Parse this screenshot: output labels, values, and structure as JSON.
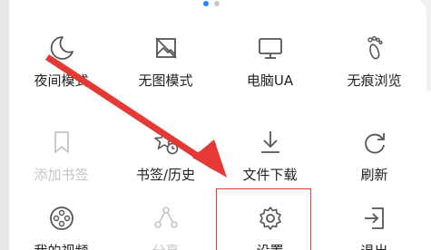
{
  "menu": {
    "rows": [
      [
        {
          "label": "夜间模式",
          "icon": "moon-icon"
        },
        {
          "label": "无图模式",
          "icon": "no-image-icon"
        },
        {
          "label": "电脑UA",
          "icon": "monitor-icon"
        },
        {
          "label": "无痕浏览",
          "icon": "footprint-icon"
        }
      ],
      [
        {
          "label": "添加书签",
          "icon": "bookmark-icon",
          "disabled": true
        },
        {
          "label": "书签/历史",
          "icon": "star-history-icon"
        },
        {
          "label": "文件下载",
          "icon": "download-icon"
        },
        {
          "label": "刷新",
          "icon": "refresh-icon"
        }
      ],
      [
        {
          "label": "我的视频",
          "icon": "film-reel-icon"
        },
        {
          "label": "分享",
          "icon": "share-icon",
          "disabled": true
        },
        {
          "label": "设置",
          "icon": "gear-icon"
        },
        {
          "label": "退出",
          "icon": "exit-icon"
        }
      ]
    ]
  },
  "pager": {
    "pages": 2,
    "active": 1
  },
  "colors": {
    "accent": "#1e88ff",
    "annotation": "#e53935",
    "disabled": "#c4c4c4",
    "text": "#222222"
  }
}
